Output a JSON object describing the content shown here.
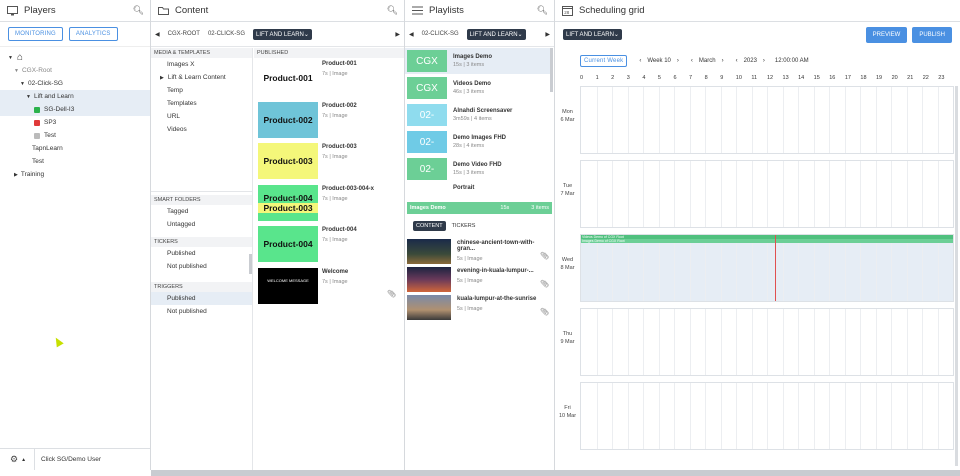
{
  "players": {
    "title": "Players",
    "monitoring": "MONITORING",
    "analytics": "ANALYTICS",
    "tree": [
      "CGX-Root",
      "02-Click-SG",
      "Lift and Learn",
      "SG-Dell-I3",
      "SP3",
      "Test",
      "TapnLearn",
      "Test",
      "Training"
    ],
    "footer_user": "Click SG/Demo User"
  },
  "content": {
    "title": "Content",
    "crumbs": [
      "CGX-ROOT",
      "02-CLICK-SG",
      "LIFT AND LEARN"
    ],
    "media_header": "MEDIA & TEMPLATES",
    "published_header": "PUBLISHED",
    "media_items": [
      "Images X",
      "Lift & Learn Content",
      "Temp",
      "Templates",
      "URL",
      "Videos"
    ],
    "smart_folders_header": "SMART FOLDERS",
    "smart_items": [
      "Tagged",
      "Untagged"
    ],
    "tickers_header": "TICKERS",
    "ticker_items": [
      "Published",
      "Not published"
    ],
    "triggers_header": "TRIGGERS",
    "trigger_items": [
      "Published",
      "Not published"
    ],
    "products": [
      {
        "thumb": "Product-001",
        "name": "Product-001",
        "meta": "7s | Image",
        "color": "#ffffff"
      },
      {
        "thumb": "Product-002",
        "name": "Product-002",
        "meta": "7s | Image",
        "color": "#6fc4d8"
      },
      {
        "thumb": "Product-003",
        "name": "Product-003",
        "meta": "7s | Image",
        "color": "#f4f77a"
      },
      {
        "thumb": "Product-004",
        "thumb2": "Product-003",
        "name": "Product-003-004-x",
        "meta": "7s | Image",
        "color": "#59e58c"
      },
      {
        "thumb": "Product-004",
        "name": "Product-004",
        "meta": "7s | Image",
        "color": "#59e58c"
      },
      {
        "thumb": "WELCOME MESSAGE",
        "name": "Welcome",
        "meta": "7s | Image",
        "color": "#000000"
      }
    ]
  },
  "playlists": {
    "title": "Playlists",
    "crumbs": [
      "02-CLICK-SG",
      "LIFT AND LEARN"
    ],
    "items": [
      {
        "thumb": "CGX",
        "name": "Images Demo",
        "meta": "15s | 3 items",
        "color": "#6ccf96"
      },
      {
        "thumb": "CGX",
        "name": "Videos Demo",
        "meta": "46s | 3 items",
        "color": "#6ccf96"
      },
      {
        "thumb": "02-",
        "name": "Alnahdi Screensaver",
        "meta": "3m59s | 4 items",
        "color": "#8fdcee"
      },
      {
        "thumb": "02-",
        "name": "Demo Images FHD",
        "meta": "28s | 4 items",
        "color": "#6fcbe6"
      },
      {
        "thumb": "02-",
        "name": "Demo Video FHD",
        "meta": "15s | 3 items",
        "color": "#6ccf96"
      },
      {
        "thumb": "",
        "name": "Portrait",
        "meta": "",
        "color": "#6fcbe6"
      }
    ],
    "selected_bar": {
      "name": "Images Demo",
      "duration": "15s",
      "count": "3 items"
    },
    "tab_content": "CONTENT",
    "tab_tickers": "TICKERS",
    "media": [
      {
        "name": "chinese-ancient-town-with-gran...",
        "meta": "5s | Image"
      },
      {
        "name": "evening-in-kuala-lumpur-...",
        "meta": "5s | Image"
      },
      {
        "name": "kuala-lumpur-at-the-sunrise",
        "meta": "5s | Image"
      }
    ]
  },
  "schedule": {
    "title": "Scheduling grid",
    "crumb": "LIFT AND LEARN",
    "preview": "PREVIEW",
    "publish": "PUBLISH",
    "current_week": "Current Week",
    "week": "Week 10",
    "month": "March",
    "year": "2023",
    "time": "12:00:00 AM",
    "hours": [
      "0",
      "1",
      "2",
      "3",
      "4",
      "5",
      "6",
      "7",
      "8",
      "9",
      "10",
      "11",
      "12",
      "13",
      "14",
      "15",
      "16",
      "17",
      "18",
      "19",
      "20",
      "21",
      "22",
      "23"
    ],
    "days": [
      {
        "d": "Mon",
        "n": "6 Mar"
      },
      {
        "d": "Tue",
        "n": "7 Mar"
      },
      {
        "d": "Wed",
        "n": "8 Mar"
      },
      {
        "d": "Thu",
        "n": "9 Mar"
      },
      {
        "d": "Fri",
        "n": "10 Mar"
      }
    ],
    "event1": "Videos Demo of CGX Root",
    "event2": "Images Demo of CGX Root"
  }
}
